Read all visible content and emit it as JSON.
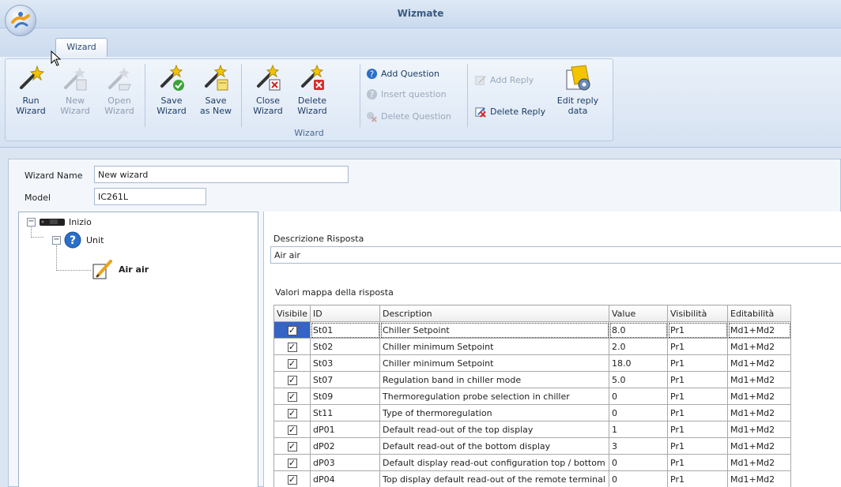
{
  "window": {
    "title": "Wizmate"
  },
  "tabs": [
    {
      "label": "Wizard",
      "active": true
    }
  ],
  "ribbon": {
    "group_label": "Wizard",
    "big_buttons": [
      {
        "name": "run-wizard-button",
        "label1": "Run",
        "label2": "Wizard",
        "enabled": true,
        "icon": "magic-wand-icon"
      },
      {
        "name": "new-wizard-button",
        "label1": "New",
        "label2": "Wizard",
        "enabled": false,
        "icon": "new-wand-icon"
      },
      {
        "name": "open-wizard-button",
        "label1": "Open",
        "label2": "Wizard",
        "enabled": false,
        "icon": "open-wand-icon"
      },
      {
        "name": "save-wizard-button",
        "label1": "Save",
        "label2": "Wizard",
        "enabled": true,
        "icon": "save-wand-icon"
      },
      {
        "name": "save-as-new-button",
        "label1": "Save",
        "label2": "as New",
        "enabled": true,
        "icon": "save-as-wand-icon"
      },
      {
        "name": "close-wizard-button",
        "label1": "Close",
        "label2": "Wizard",
        "enabled": true,
        "icon": "close-wand-icon"
      },
      {
        "name": "delete-wizard-button",
        "label1": "Delete",
        "label2": "Wizard",
        "enabled": true,
        "icon": "delete-wand-icon"
      }
    ],
    "question_buttons": {
      "add_question": "Add Question",
      "insert_question": "Insert question",
      "delete_question": "Delete Question"
    },
    "reply_buttons": {
      "add_reply": "Add Reply",
      "delete_reply": "Delete Reply",
      "edit_reply_1": "Edit reply",
      "edit_reply_2": "data"
    }
  },
  "form": {
    "wizard_name_label": "Wizard Name",
    "wizard_name_value": "New wizard",
    "model_label": "Model",
    "model_value": "IC261L"
  },
  "tree": {
    "root": "Inizio",
    "child": "Unit",
    "leaf": "Air air"
  },
  "detail": {
    "description_label": "Descrizione Risposta",
    "description_value": "Air air",
    "map_label": "Valori mappa della risposta"
  },
  "grid": {
    "headers": {
      "visible": "Visibile",
      "id": "ID",
      "description": "Description",
      "value": "Value",
      "visibility": "Visibilità",
      "editability": "Editabilità"
    },
    "rows": [
      {
        "visible": true,
        "id": "St01",
        "description": "Chiller Setpoint",
        "value": "8.0",
        "visibility": "Pr1",
        "editability": "Md1+Md2"
      },
      {
        "visible": true,
        "id": "St02",
        "description": "Chiller minimum Setpoint",
        "value": "2.0",
        "visibility": "Pr1",
        "editability": "Md1+Md2"
      },
      {
        "visible": true,
        "id": "St03",
        "description": "Chiller minimum Setpoint",
        "value": "18.0",
        "visibility": "Pr1",
        "editability": "Md1+Md2"
      },
      {
        "visible": true,
        "id": "St07",
        "description": "Regulation band in chiller mode",
        "value": "5.0",
        "visibility": "Pr1",
        "editability": "Md1+Md2"
      },
      {
        "visible": true,
        "id": "St09",
        "description": "Thermoregulation probe selection  in chiller",
        "value": "0",
        "visibility": "Pr1",
        "editability": "Md1+Md2"
      },
      {
        "visible": true,
        "id": "St11",
        "description": "Type of thermoregulation",
        "value": "0",
        "visibility": "Pr1",
        "editability": "Md1+Md2"
      },
      {
        "visible": true,
        "id": "dP01",
        "description": "Default read-out of the top display",
        "value": "1",
        "visibility": "Pr1",
        "editability": "Md1+Md2"
      },
      {
        "visible": true,
        "id": "dP02",
        "description": "Default read-out of the bottom display",
        "value": "3",
        "visibility": "Pr1",
        "editability": "Md1+Md2"
      },
      {
        "visible": true,
        "id": "dP03",
        "description": "Default display read-out configuration  top / bottom",
        "value": "0",
        "visibility": "Pr1",
        "editability": "Md1+Md2"
      },
      {
        "visible": true,
        "id": "dP04",
        "description": "Top display default read-out of the remote terminal",
        "value": "0",
        "visibility": "Pr1",
        "editability": "Md1+Md2"
      }
    ]
  }
}
